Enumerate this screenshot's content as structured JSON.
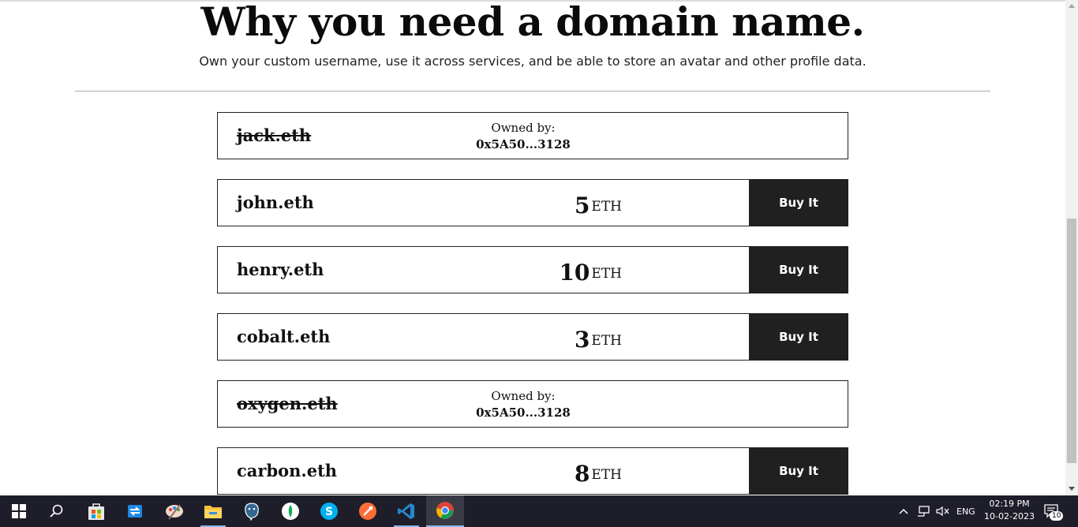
{
  "hero": {
    "title": "Why you need a domain name.",
    "subtitle": "Own your custom username, use it across services, and be able to store an avatar and other profile data."
  },
  "domains": [
    {
      "name": "jack.eth",
      "status": "owned",
      "owned_label": "Owned by:",
      "owner": "0x5A50...3128"
    },
    {
      "name": "john.eth",
      "status": "available",
      "price": "5",
      "unit": "ETH",
      "button": "Buy It"
    },
    {
      "name": "henry.eth",
      "status": "available",
      "price": "10",
      "unit": "ETH",
      "button": "Buy It"
    },
    {
      "name": "cobalt.eth",
      "status": "available",
      "price": "3",
      "unit": "ETH",
      "button": "Buy It"
    },
    {
      "name": "oxygen.eth",
      "status": "owned",
      "owned_label": "Owned by:",
      "owner": "0x5A50...3128"
    },
    {
      "name": "carbon.eth",
      "status": "available",
      "price": "8",
      "unit": "ETH",
      "button": "Buy It"
    }
  ],
  "taskbar": {
    "apps": [
      "windows-start-icon",
      "search-icon",
      "microsoft-store-icon",
      "mail-sync-icon",
      "paint-icon",
      "file-explorer-icon",
      "postgresql-icon",
      "mongodb-compass-icon",
      "skype-icon",
      "postman-icon",
      "vscode-icon",
      "chrome-icon"
    ],
    "tray": {
      "language": "ENG",
      "time": "02:19 PM",
      "date": "10-02-2023",
      "notifications": "10"
    }
  },
  "colors": {
    "button_bg": "#202020",
    "taskbar_bg": "#1e1e2a",
    "accent": "#8fb4e8"
  }
}
